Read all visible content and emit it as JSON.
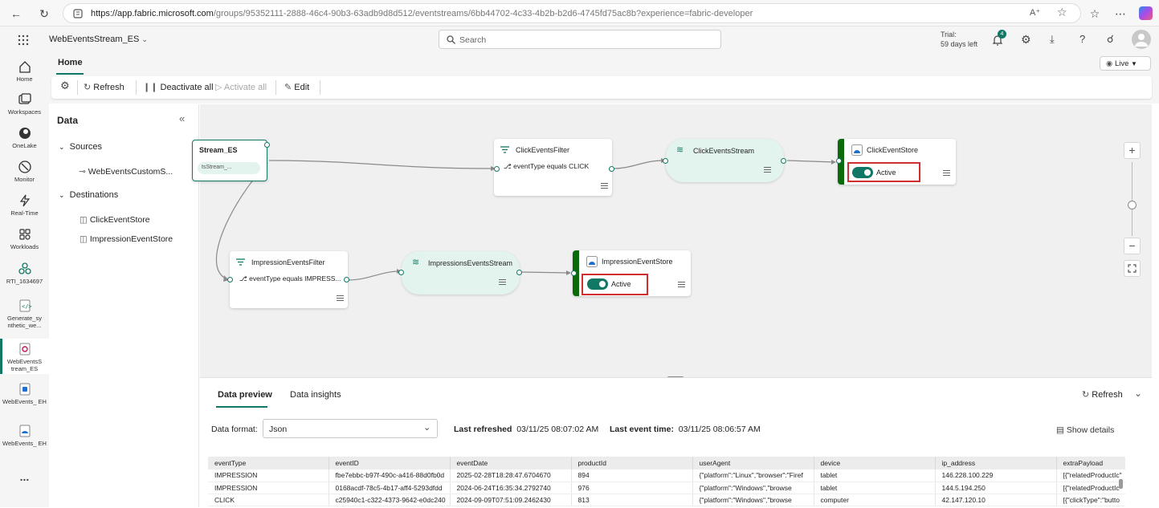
{
  "browser": {
    "url_host": "https://app.fabric.microsoft.com",
    "url_path": "/groups/95352111-2888-46c4-90b3-63adb9d8d512/eventstreams/6bb44702-4c33-4b2b-b2d6-4745fd75ac8b?experience=fabric-developer"
  },
  "appbar": {
    "item_name": "WebEventsStream_ES",
    "search_placeholder": "Search",
    "trial_line1": "Trial:",
    "trial_line2": "59 days left",
    "notification_count": "4"
  },
  "leftnav": [
    {
      "label": "Home"
    },
    {
      "label": "Workspaces"
    },
    {
      "label": "OneLake"
    },
    {
      "label": "Monitor"
    },
    {
      "label": "Real-Time"
    },
    {
      "label": "Workloads"
    },
    {
      "label": "RTI_1634697"
    },
    {
      "label": "Generate_sy nthetic_we..."
    },
    {
      "label": "WebEventsS tream_ES"
    },
    {
      "label": "WebEvents_ EH"
    },
    {
      "label": "WebEvents_ EH"
    },
    {
      "label": "..."
    }
  ],
  "ribbon": {
    "tab_home": "Home",
    "live_label": "Live",
    "refresh": "Refresh",
    "deactivate_all": "Deactivate all",
    "activate_all": "Activate all",
    "edit": "Edit"
  },
  "data_panel": {
    "title": "Data",
    "sources_label": "Sources",
    "sources": [
      "WebEventsCustomS..."
    ],
    "destinations_label": "Destinations",
    "destinations": [
      "ClickEventStore",
      "ImpressionEventStore"
    ]
  },
  "canvas": {
    "source_node": {
      "title": "Stream_ES",
      "sub": "tsStream_..."
    },
    "click_filter": {
      "title": "ClickEventsFilter",
      "condition": "eventType equals CLICK"
    },
    "click_stream": {
      "title": "ClickEventsStream"
    },
    "click_store": {
      "title": "ClickEventStore",
      "status": "Active"
    },
    "impression_filter": {
      "title": "ImpressionEventsFilter",
      "condition": "eventType equals IMPRESS..."
    },
    "impression_stream": {
      "title": "ImpressionsEventsStream"
    },
    "impression_store": {
      "title": "ImpressionEventStore",
      "status": "Active"
    }
  },
  "bottom": {
    "tab_preview": "Data preview",
    "tab_insights": "Data insights",
    "refresh": "Refresh",
    "format_label": "Data format:",
    "format_value": "Json",
    "last_refreshed_label": "Last refreshed",
    "last_refreshed_value": "03/11/25 08:07:02 AM",
    "last_event_label": "Last event time:",
    "last_event_value": "03/11/25 08:06:57 AM",
    "show_details": "Show details",
    "columns": [
      "eventType",
      "eventID",
      "eventDate",
      "productId",
      "userAgent",
      "device",
      "ip_address",
      "extraPayload"
    ],
    "rows": [
      [
        "IMPRESSION",
        "fbe7ebbc-b97f-490c-a416-88d0fb0d",
        "2025-02-28T18:28:47.6704670",
        "894",
        "{\"platform\":\"Linux\",\"browser\":\"Firef",
        "tablet",
        "146.228.100.229",
        "[{\"relatedProductIc\""
      ],
      [
        "IMPRESSION",
        "0168acdf-78c5-4b17-aff4-5293dfdd",
        "2024-06-24T16:35:34.2792740",
        "976",
        "{\"platform\":\"Windows\",\"browse",
        "tablet",
        "144.5.194.250",
        "[{\"relatedProductIc\""
      ],
      [
        "CLICK",
        "c25940c1-c322-4373-9642-e0dc240",
        "2024-09-09T07:51:09.2462430",
        "813",
        "{\"platform\":\"Windows\",\"browse",
        "computer",
        "42.147.120.10",
        "[{\"clickType\":\"butto"
      ]
    ]
  }
}
